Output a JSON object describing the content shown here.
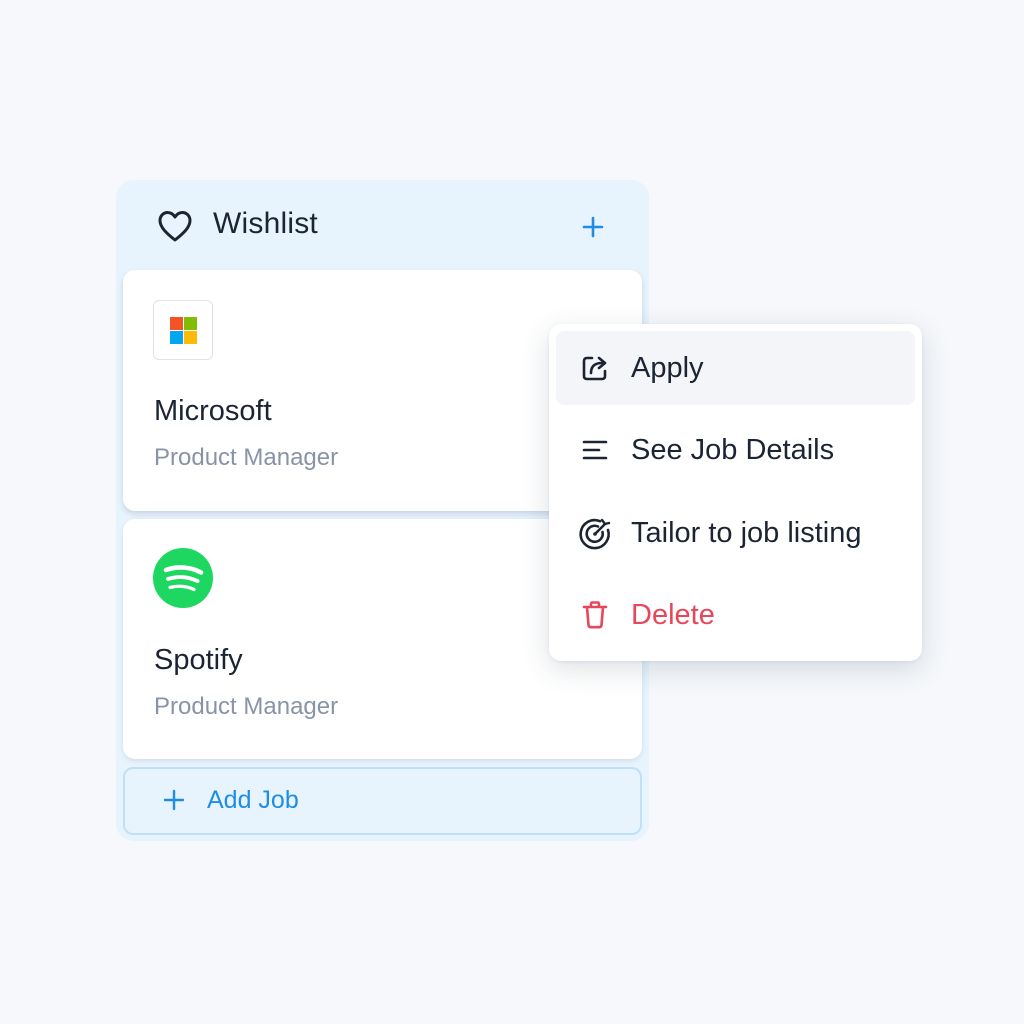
{
  "colors": {
    "background": "#f6f8fb",
    "column_background": "#e7f3fd",
    "accent": "#1f8de6",
    "danger": "#e8465a",
    "text_primary": "#1c2433",
    "text_secondary": "#8893a7",
    "spotify_green": "#1ed760"
  },
  "column": {
    "title": "Wishlist",
    "title_icon": "heart-icon",
    "add_icon": "plus-icon"
  },
  "jobs": [
    {
      "company": "Microsoft",
      "title": "Product Manager",
      "logo": "microsoft-logo"
    },
    {
      "company": "Spotify",
      "title": "Product Manager",
      "logo": "spotify-logo"
    }
  ],
  "add_job": {
    "label": "Add Job",
    "icon": "plus-icon"
  },
  "context_menu": {
    "items": [
      {
        "label": "Apply",
        "icon": "share-icon",
        "highlighted": true
      },
      {
        "label": "See Job Details",
        "icon": "lines-icon"
      },
      {
        "label": "Tailor to job listing",
        "icon": "target-icon"
      },
      {
        "label": "Delete",
        "icon": "trash-icon",
        "danger": true
      }
    ]
  }
}
